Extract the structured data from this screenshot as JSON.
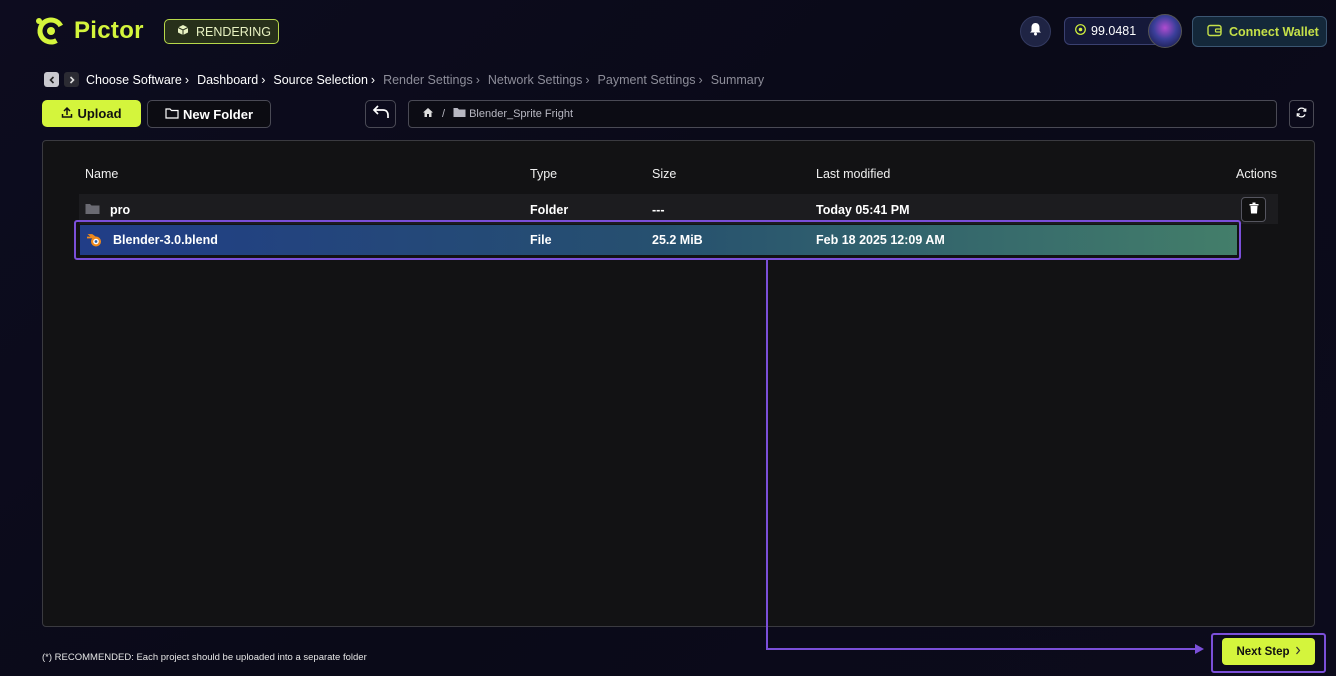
{
  "app": {
    "name": "Pictor",
    "mode_badge": "RENDERING",
    "balance": "99.0481",
    "connect_wallet_label": "Connect Wallet"
  },
  "breadcrumb": [
    {
      "label": "Choose Software",
      "state": "active"
    },
    {
      "label": "Dashboard",
      "state": "active"
    },
    {
      "label": "Source Selection",
      "state": "active"
    },
    {
      "label": "Render Settings",
      "state": "inactive"
    },
    {
      "label": "Network Settings",
      "state": "inactive"
    },
    {
      "label": "Payment Settings",
      "state": "inactive"
    },
    {
      "label": "Summary",
      "state": "inactive"
    }
  ],
  "toolbar": {
    "upload_label": "Upload",
    "new_folder_label": "New Folder",
    "path_folder": "Blender_Sprite Fright"
  },
  "table": {
    "headers": {
      "name": "Name",
      "type": "Type",
      "size": "Size",
      "modified": "Last modified",
      "actions": "Actions"
    },
    "rows": [
      {
        "name": "pro",
        "type": "Folder",
        "size": "---",
        "modified": "Today 05:41 PM",
        "icon": "folder-icon"
      },
      {
        "name": "Blender-3.0.blend",
        "type": "File",
        "size": "25.2 MiB",
        "modified": "Feb 18 2025 12:09 AM",
        "icon": "blender-icon"
      }
    ]
  },
  "footer": {
    "note": "(*) RECOMMENDED: Each project should be uploaded into a separate folder",
    "next_label": "Next Step"
  },
  "colors": {
    "accent": "#d4f53c",
    "highlight": "#7b4fd9",
    "background": "#0d0c1f"
  }
}
